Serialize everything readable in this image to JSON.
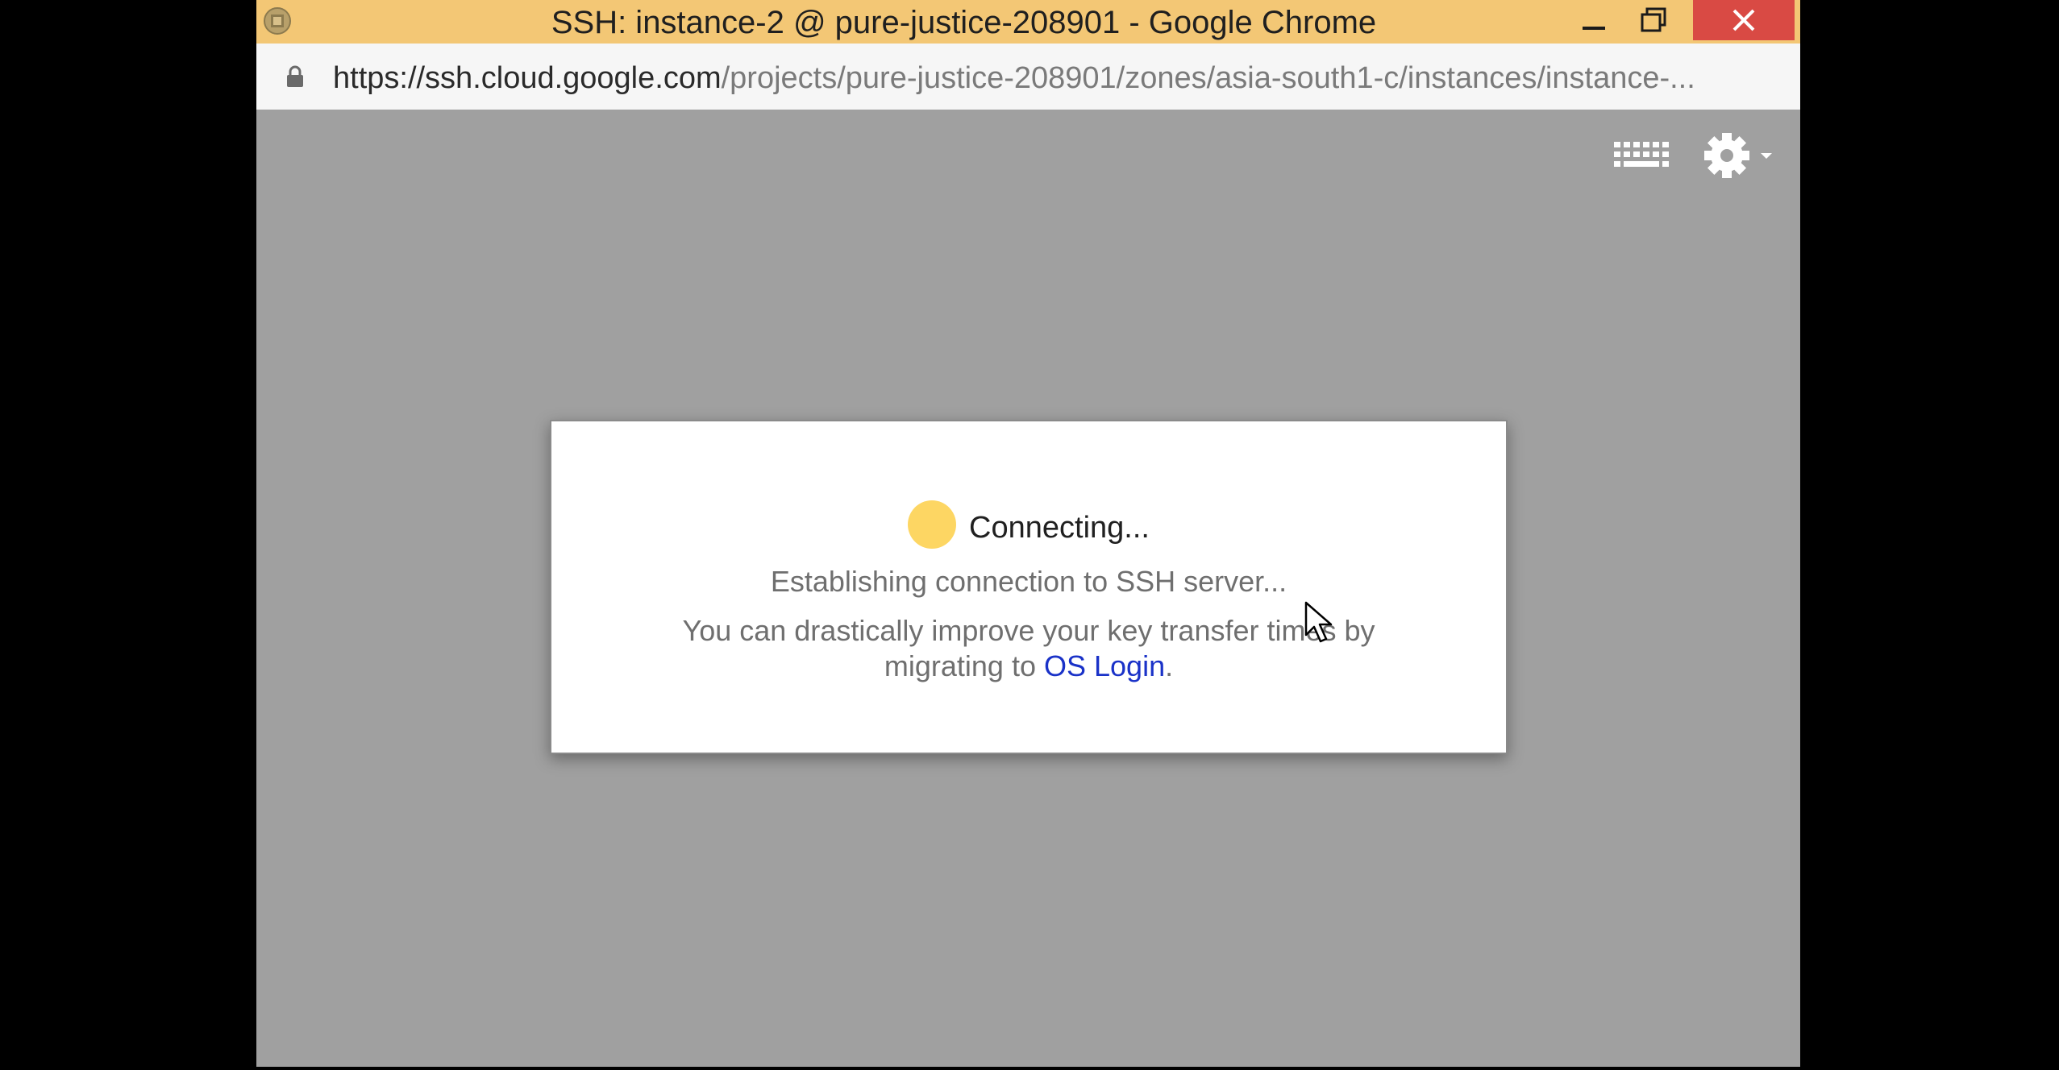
{
  "window": {
    "title": "SSH: instance-2 @ pure-justice-208901 - Google Chrome",
    "controls": {
      "minimize": "minimize-icon",
      "maximize": "restore-icon",
      "close": "close-icon"
    }
  },
  "address_bar": {
    "url_host": "https://ssh.cloud.google.com",
    "url_path": "/projects/pure-justice-208901/zones/asia-south1-c/instances/instance-..."
  },
  "toolbar": {
    "keyboard_icon": "keyboard-icon",
    "settings_icon": "gear-icon"
  },
  "dialog": {
    "status": "Connecting...",
    "detail": "Establishing connection to SSH server...",
    "tip_before_link": "You can drastically improve your key transfer times by migrating to ",
    "link_text": "OS Login",
    "tip_after_link": "."
  },
  "colors": {
    "titlebar": "#f3c775",
    "close_button": "#d94a44",
    "status_dot": "#fdd663",
    "link": "#1a32c8",
    "background": "#a0a0a0"
  }
}
